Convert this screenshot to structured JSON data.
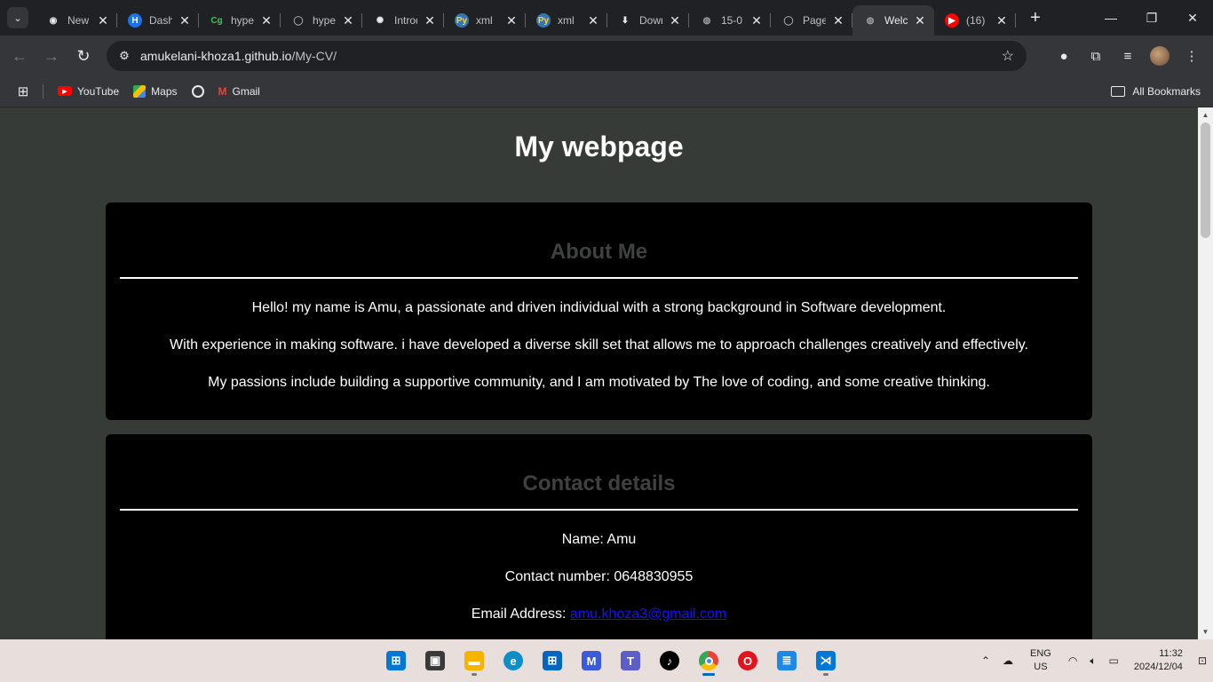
{
  "browser": {
    "tabs": [
      {
        "title": "New Tab",
        "fav": "chrome-icon",
        "fav_glyph": "◉",
        "fav_color": "#e8eaed",
        "fav_bg": "transparent"
      },
      {
        "title": "Dashboard",
        "fav": "hyperion-dashboard-icon",
        "fav_glyph": "H",
        "fav_color": "#ffffff",
        "fav_bg": "#1a73e8"
      },
      {
        "title": "hyperiondev",
        "fav": "codegrade-icon",
        "fav_glyph": "Cg",
        "fav_color": "#34c759",
        "fav_bg": "transparent"
      },
      {
        "title": "hyperiondev",
        "fav": "github-icon",
        "fav_glyph": "◯",
        "fav_color": "#9aa0a6",
        "fav_bg": "transparent"
      },
      {
        "title": "Introduction",
        "fav": "openai-icon",
        "fav_glyph": "✺",
        "fav_color": "#e8eaed",
        "fav_bg": "transparent"
      },
      {
        "title": "xml",
        "fav": "python-icon",
        "fav_glyph": "Py",
        "fav_color": "#ffd43b",
        "fav_bg": "#3776ab"
      },
      {
        "title": "xml",
        "fav": "python-icon",
        "fav_glyph": "Py",
        "fav_color": "#ffd43b",
        "fav_bg": "#3776ab"
      },
      {
        "title": "Downloads",
        "fav": "download-icon",
        "fav_glyph": "⬇",
        "fav_color": "#e8eaed",
        "fav_bg": "transparent"
      },
      {
        "title": "15-0",
        "fav": "globe-icon",
        "fav_glyph": "◍",
        "fav_color": "#9aa0a6",
        "fav_bg": "transparent"
      },
      {
        "title": "Pages",
        "fav": "github-icon",
        "fav_glyph": "◯",
        "fav_color": "#9aa0a6",
        "fav_bg": "transparent"
      },
      {
        "title": "Welcome",
        "fav": "globe-icon",
        "fav_glyph": "◍",
        "fav_color": "#9aa0a6",
        "fav_bg": "transparent",
        "active": true
      },
      {
        "title": "(16)",
        "fav": "youtube-icon",
        "fav_glyph": "▶",
        "fav_color": "#ffffff",
        "fav_bg": "#ff0000"
      }
    ],
    "url_host": "amukelani-khoza1.github.io",
    "url_path": "/My-CV/",
    "bookmarks": {
      "youtube": "YouTube",
      "maps": "Maps",
      "gmail": "Gmail",
      "all": "All Bookmarks"
    }
  },
  "page": {
    "title": "My webpage",
    "about": {
      "heading": "About Me",
      "paragraphs": [
        "Hello! my name is Amu, a passionate and driven individual with a strong background in Software development.",
        "With experience in making software. i have developed a diverse skill set that allows me to approach challenges creatively and effectively.",
        "My passions include building a supportive community, and I am motivated by The love of coding, and some creative thinking."
      ]
    },
    "contact": {
      "heading": "Contact details",
      "name": "Name: Amu",
      "number": "Contact number: 0648830955",
      "email_label": "Email Address: ",
      "email": "amu.khoza3@gmail.com"
    }
  },
  "taskbar": {
    "language": "ENG",
    "region": "US",
    "time": "11:32",
    "date": "2024/12/04"
  },
  "colors": {
    "page_bg": "#363b38",
    "card_bg": "#000000",
    "heading_gray": "#3f4140",
    "link": "#1a0dff"
  }
}
